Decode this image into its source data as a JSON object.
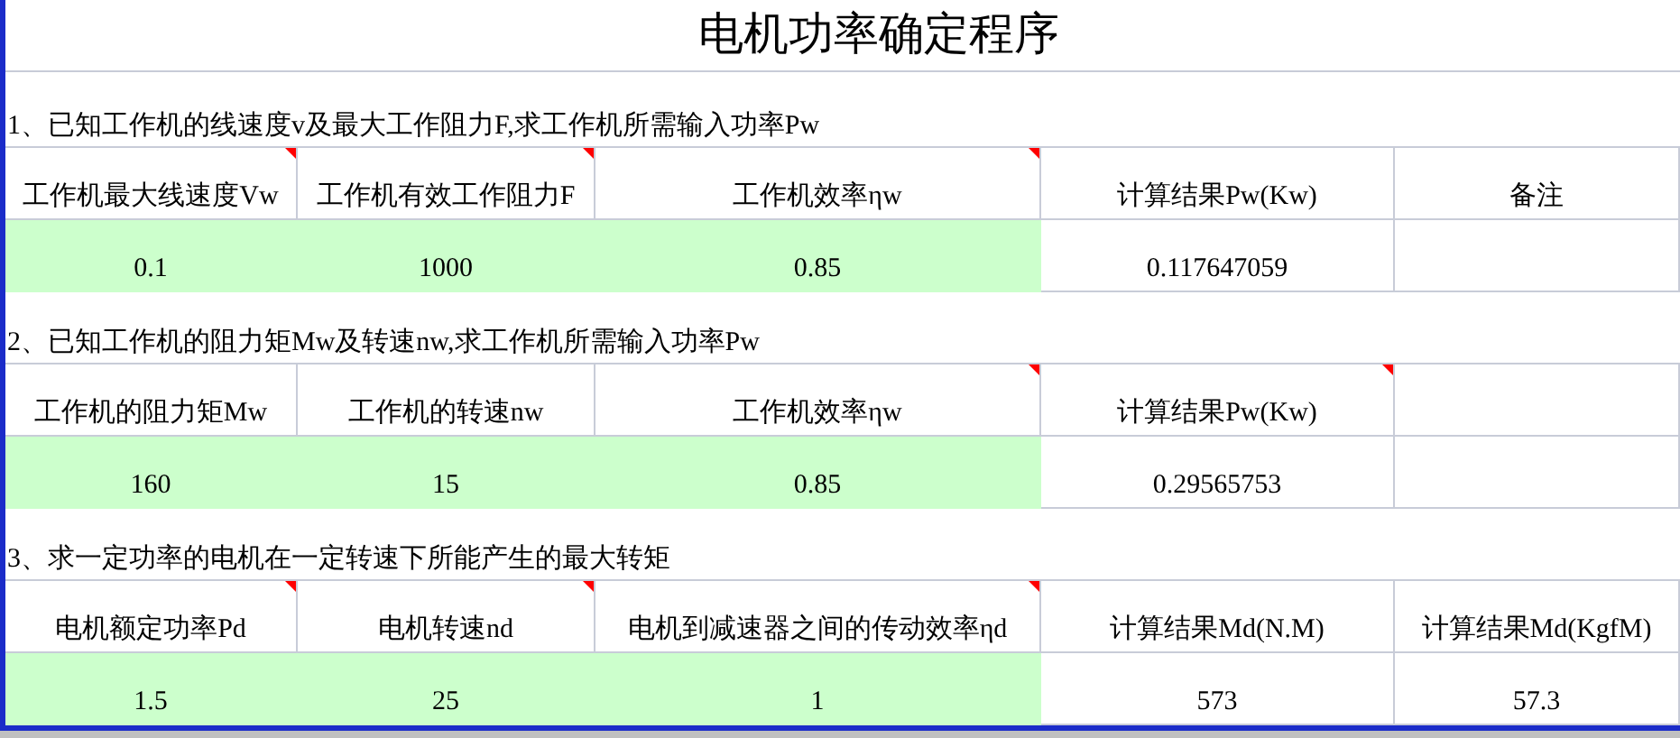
{
  "title": "电机功率确定程序",
  "sections": [
    {
      "heading": "1、已知工作机的线速度v及最大工作阻力F,求工作机所需输入功率Pw",
      "headers": [
        {
          "text": "工作机最大线速度Vw",
          "comment": true
        },
        {
          "text": "工作机有效工作阻力F",
          "comment": true
        },
        {
          "text": "工作机效率ηw",
          "comment": true
        },
        {
          "text": "计算结果Pw(Kw)",
          "comment": false
        },
        {
          "text": "备注",
          "comment": false
        }
      ],
      "values": [
        {
          "text": "0.1",
          "kind": "input"
        },
        {
          "text": "1000",
          "kind": "input"
        },
        {
          "text": "0.85",
          "kind": "input"
        },
        {
          "text": "0.117647059",
          "kind": "result"
        },
        {
          "kind": "result"
        }
      ]
    },
    {
      "heading": "2、已知工作机的阻力矩Mw及转速nw,求工作机所需输入功率Pw",
      "headers": [
        {
          "text": "工作机的阻力矩Mw",
          "comment": false
        },
        {
          "text": "工作机的转速nw",
          "comment": false
        },
        {
          "text": "工作机效率ηw",
          "comment": true
        },
        {
          "text": "计算结果Pw(Kw)",
          "comment": true
        },
        {
          "comment": false
        }
      ],
      "values": [
        {
          "text": "160",
          "kind": "input"
        },
        {
          "text": "15",
          "kind": "input"
        },
        {
          "text": "0.85",
          "kind": "input"
        },
        {
          "text": "0.29565753",
          "kind": "result"
        },
        {
          "kind": "result"
        }
      ]
    },
    {
      "heading": "3、求一定功率的电机在一定转速下所能产生的最大转矩",
      "headers": [
        {
          "text": "电机额定功率Pd",
          "comment": true
        },
        {
          "text": "电机转速nd",
          "comment": true
        },
        {
          "text": "电机到减速器之间的传动效率ηd",
          "comment": true
        },
        {
          "text": "计算结果Md(N.M)",
          "comment": false
        },
        {
          "text": "计算结果Md(KgfM)",
          "comment": false
        }
      ],
      "values": [
        {
          "text": "1.5",
          "kind": "input"
        },
        {
          "text": "25",
          "kind": "input"
        },
        {
          "text": "1",
          "kind": "input"
        },
        {
          "text": "573",
          "kind": "result"
        },
        {
          "text": "57.3",
          "kind": "result"
        }
      ]
    }
  ]
}
